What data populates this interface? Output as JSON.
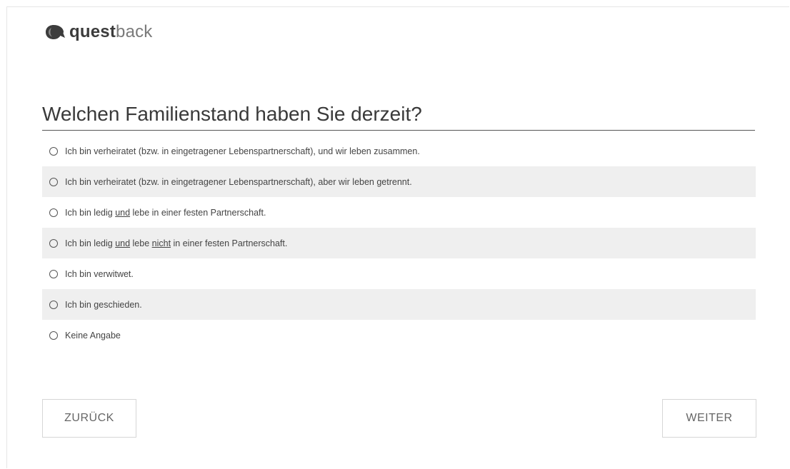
{
  "brand": {
    "logo_icon": "questback-logo-icon",
    "name_bold": "quest",
    "name_light": "back",
    "accent_color": "#3c3c3c"
  },
  "question": {
    "title": "Welchen Familienstand haben Sie derzeit?"
  },
  "options": [
    {
      "before": "Ich bin verheiratet (bzw. in eingetragener Lebenspartnerschaft), und wir leben zusammen.",
      "u1": "",
      "mid": "",
      "u2": "",
      "after": "",
      "selected": false
    },
    {
      "before": "Ich bin verheiratet (bzw. in eingetragener Lebenspartnerschaft), aber wir leben getrennt.",
      "u1": "",
      "mid": "",
      "u2": "",
      "after": "",
      "selected": false
    },
    {
      "before": "Ich bin ledig ",
      "u1": "und",
      "mid": " lebe in einer festen Partnerschaft.",
      "u2": "",
      "after": "",
      "selected": false
    },
    {
      "before": "Ich bin ledig ",
      "u1": "und",
      "mid": " lebe ",
      "u2": "nicht",
      "after": " in einer festen Partnerschaft.",
      "selected": false
    },
    {
      "before": "Ich bin verwitwet.",
      "u1": "",
      "mid": "",
      "u2": "",
      "after": "",
      "selected": false
    },
    {
      "before": "Ich bin geschieden.",
      "u1": "",
      "mid": "",
      "u2": "",
      "after": "",
      "selected": false
    },
    {
      "before": "Keine Angabe",
      "u1": "",
      "mid": "",
      "u2": "",
      "after": "",
      "selected": false
    }
  ],
  "navigation": {
    "back_label": "ZURÜCK",
    "next_label": "WEITER"
  }
}
